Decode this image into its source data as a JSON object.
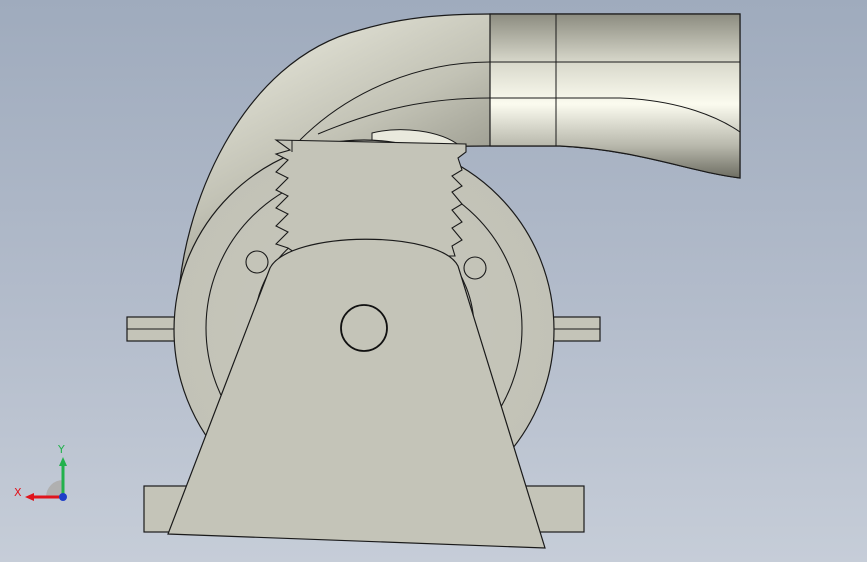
{
  "viewport": {
    "background_top": "#9fabbd",
    "background_bottom": "#c6cdd8",
    "model_face_color": "#c4c4b8",
    "pipe_highlight": "#fafaf0",
    "pipe_shadow": "#5e5e54",
    "edge_color": "#1a1a1a"
  },
  "triad": {
    "x_label": "X",
    "y_label": "Y",
    "x_color": "#e0141c",
    "y_color": "#22b14c",
    "z_color": "#1e3ec8"
  }
}
